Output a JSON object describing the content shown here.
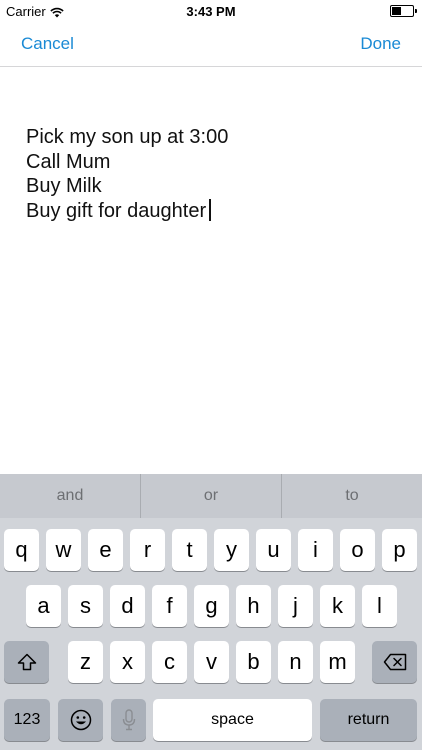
{
  "status_bar": {
    "carrier": "Carrier",
    "time": "3:43 PM"
  },
  "nav": {
    "cancel_label": "Cancel",
    "done_label": "Done"
  },
  "note": {
    "lines": [
      "Pick my son up at 3:00",
      "Call Mum",
      "Buy Milk",
      "Buy gift for daughter"
    ]
  },
  "keyboard": {
    "suggestions": [
      "and",
      "or",
      "to"
    ],
    "row1": [
      "q",
      "w",
      "e",
      "r",
      "t",
      "y",
      "u",
      "i",
      "o",
      "p"
    ],
    "row2": [
      "a",
      "s",
      "d",
      "f",
      "g",
      "h",
      "j",
      "k",
      "l"
    ],
    "row3": [
      "z",
      "x",
      "c",
      "v",
      "b",
      "n",
      "m"
    ],
    "numbers_label": "123",
    "space_label": "space",
    "return_label": "return",
    "icons": {
      "shift": "shift-icon",
      "delete": "delete-icon",
      "emoji": "emoji-icon",
      "mic": "microphone-icon"
    }
  },
  "colors": {
    "accent": "#1a8ad5",
    "keyboard_bg": "#d1d4d9",
    "dark_key": "#aab0b9"
  }
}
